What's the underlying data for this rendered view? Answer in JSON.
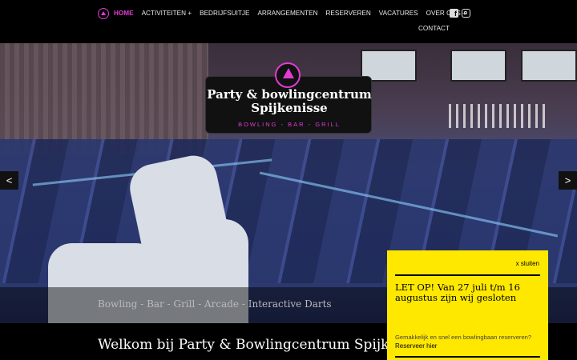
{
  "nav": {
    "items": [
      {
        "label": "Home",
        "active": true
      },
      {
        "label": "Activiteiten +",
        "active": false
      },
      {
        "label": "Bedrijfsuitje",
        "active": false
      },
      {
        "label": "Arrangementen",
        "active": false
      },
      {
        "label": "Reserveren",
        "active": false
      },
      {
        "label": "Vacatures",
        "active": false
      },
      {
        "label": "Over ons +",
        "active": false
      }
    ],
    "contact": "Contact",
    "social_icons": [
      "facebook-icon",
      "instagram-icon"
    ]
  },
  "hero": {
    "logo_title_line1": "Party & bowlingcentrum",
    "logo_title_line2": "Spijkenisse",
    "logo_subtitle": "BOWLING - BAR - GRILL",
    "arrow_left": "<",
    "arrow_right": ">",
    "tagline": "Bowling - Bar - Grill - Arcade - Interactive Darts"
  },
  "welcome": "Welkom bij Party & Bowlingcentrum Spijkenisse",
  "popup": {
    "close": "x sluiten",
    "title": "LET OP! Van 27 juli t/m 16 augustus zijn wij gesloten",
    "text": "Gemakkelijk en snel een bowlingbaan reserveren?",
    "link": "Reserveer hier"
  },
  "colors": {
    "accent": "#e23bd3",
    "popup_bg": "#ffe800",
    "nav_bg": "#000000"
  }
}
